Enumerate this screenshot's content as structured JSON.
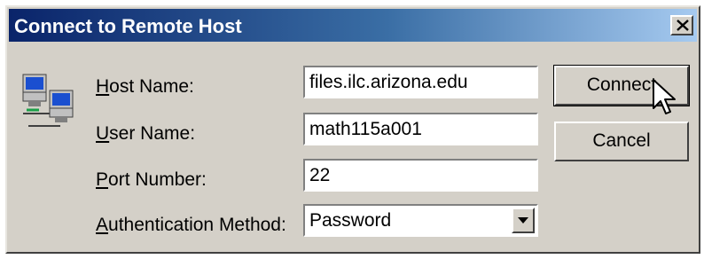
{
  "window": {
    "title": "Connect to Remote Host"
  },
  "form": {
    "host_label_key": "H",
    "host_label_rest": "ost Name:",
    "host_value": "files.ilc.arizona.edu",
    "user_label_key": "U",
    "user_label_rest": "ser Name:",
    "user_value": "math115a001",
    "port_label_key": "P",
    "port_label_rest": "ort Number:",
    "port_value": "22",
    "auth_label_key": "A",
    "auth_label_rest": "uthentication Method:",
    "auth_value": "Password"
  },
  "buttons": {
    "connect": "Connect",
    "cancel": "Cancel"
  },
  "icons": {
    "app": "network-computers-icon",
    "close": "close-icon",
    "dropdown": "chevron-down-icon",
    "pointer": "mouse-cursor-icon"
  },
  "colors": {
    "titlebar_start": "#0a246a",
    "titlebar_end": "#a6caf0",
    "face": "#d4d0c8"
  }
}
